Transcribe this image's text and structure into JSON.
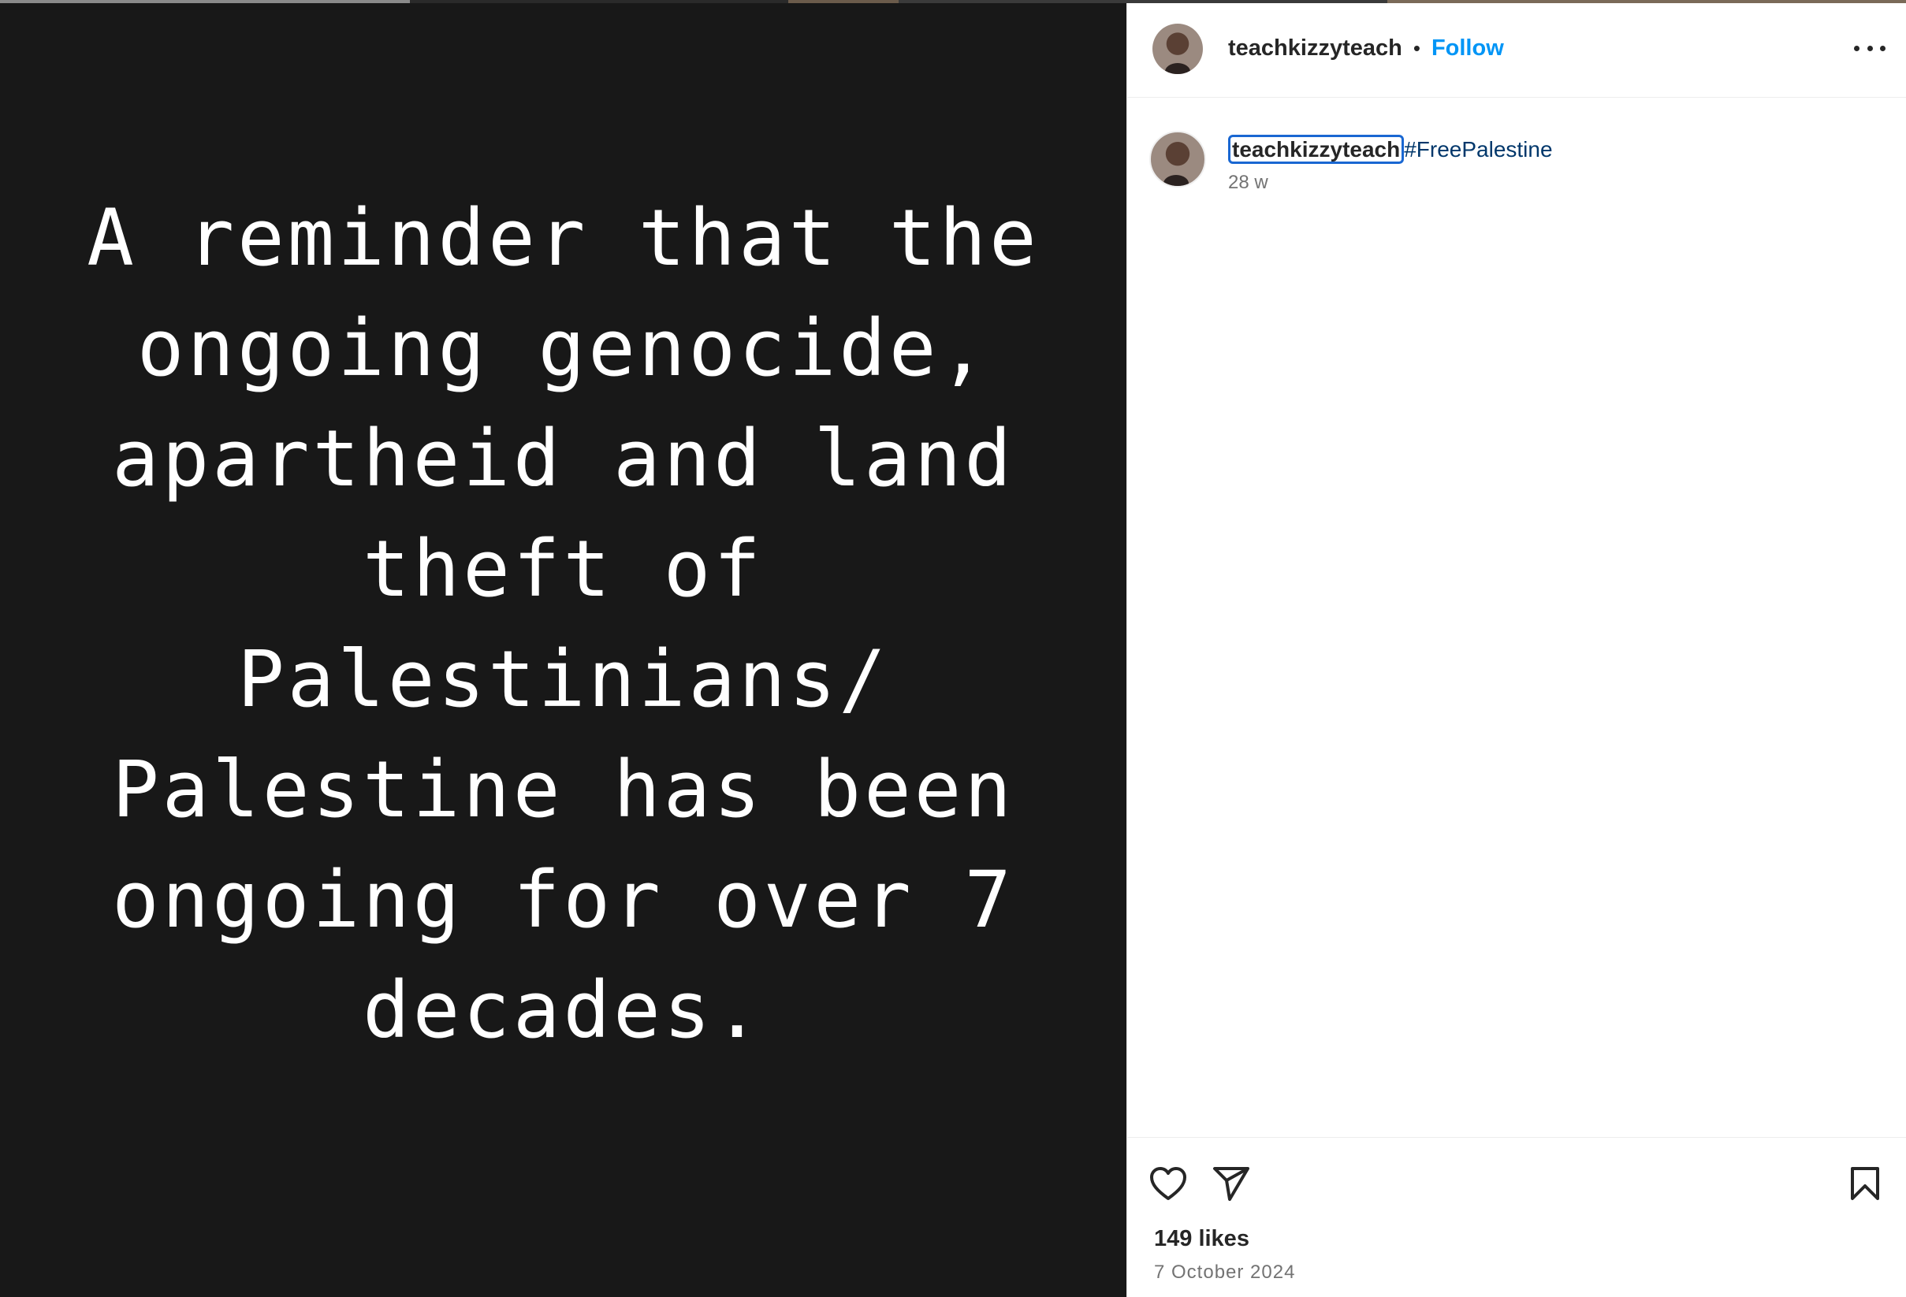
{
  "post": {
    "image_text": "A reminder that the\nongoing genocide,\napartheid and land\ntheft of\nPalestinians/\nPalestine has been\nongoing for over 7\ndecades."
  },
  "header": {
    "username": "teachkizzyteach",
    "separator": "•",
    "follow_label": "Follow"
  },
  "caption": {
    "username": "teachkizzyteach",
    "hashtag": "#FreePalestine",
    "time_ago": "28 w"
  },
  "engagement": {
    "likes": "149 likes",
    "date": "7 October 2024"
  },
  "icons": {
    "like": "heart-icon",
    "share": "paper-plane-icon",
    "save": "bookmark-icon",
    "more": "more-options-icon"
  }
}
